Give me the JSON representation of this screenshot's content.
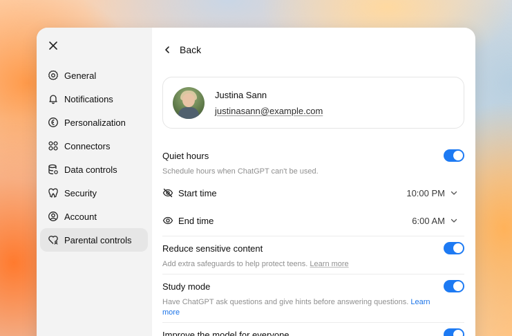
{
  "sidebar": {
    "items": [
      {
        "label": "General",
        "icon": "gear-icon"
      },
      {
        "label": "Notifications",
        "icon": "bell-icon"
      },
      {
        "label": "Personalization",
        "icon": "personalization-icon"
      },
      {
        "label": "Connectors",
        "icon": "connectors-icon"
      },
      {
        "label": "Data controls",
        "icon": "database-icon"
      },
      {
        "label": "Security",
        "icon": "shield-icon"
      },
      {
        "label": "Account",
        "icon": "user-circle-icon"
      },
      {
        "label": "Parental controls",
        "icon": "parental-controls-icon",
        "active": true
      }
    ]
  },
  "header": {
    "back_label": "Back"
  },
  "profile": {
    "name": "Justina Sann",
    "email": "justinasann@example.com"
  },
  "settings": {
    "quiet_hours": {
      "title": "Quiet hours",
      "desc": "Schedule hours when ChatGPT can't be used.",
      "enabled": true
    },
    "start_time": {
      "label": "Start time",
      "value": "10:00 PM"
    },
    "end_time": {
      "label": "End time",
      "value": "6:00 AM"
    },
    "reduce_sensitive": {
      "title": "Reduce sensitive content",
      "desc": "Add extra safeguards to help protect teens.",
      "link": "Learn more",
      "enabled": true
    },
    "study_mode": {
      "title": "Study mode",
      "desc": "Have ChatGPT ask questions and give hints before answering questions.",
      "link_a": "Learn",
      "link_b": "more",
      "enabled": true
    },
    "improve_model": {
      "title": "Improve the model for everyone",
      "enabled": true
    }
  },
  "colors": {
    "accent": "#1d7af3",
    "sidebar_bg": "#f3f3f3",
    "active_item_bg": "#e6e6e6"
  }
}
